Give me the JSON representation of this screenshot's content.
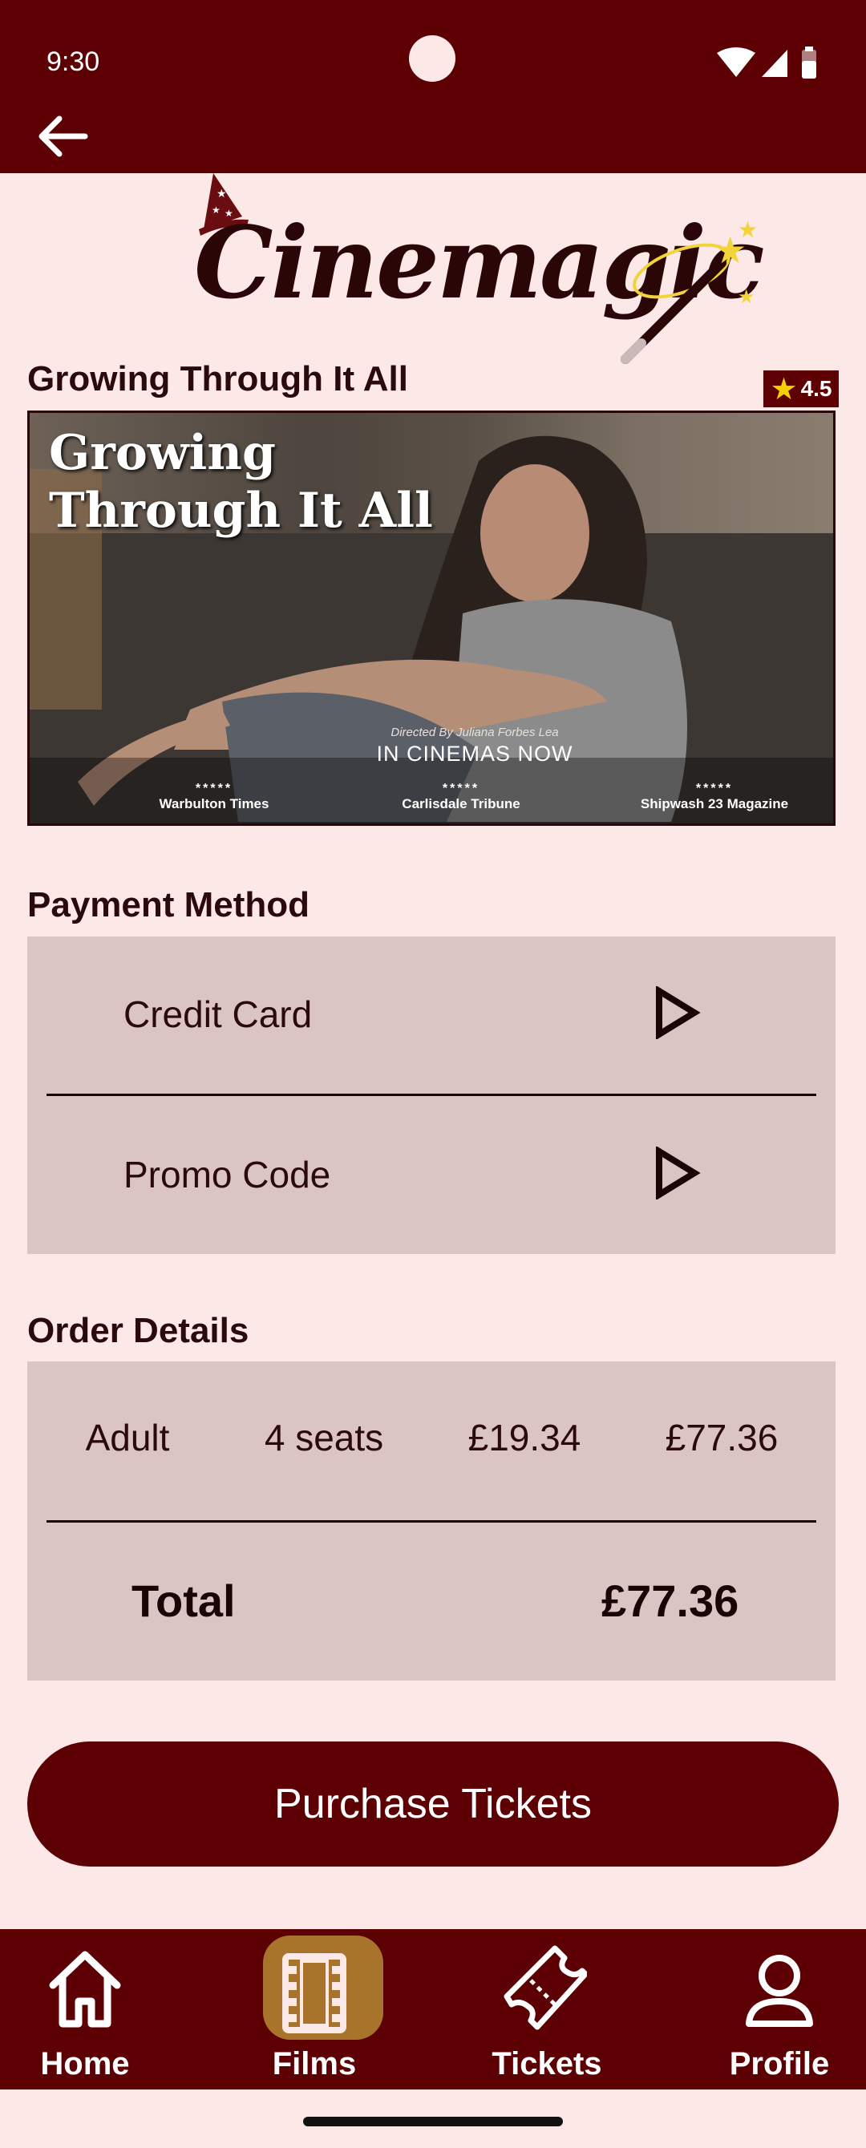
{
  "status_bar": {
    "time": "9:30"
  },
  "app_bar": {
    "back_icon": "arrow-left-icon"
  },
  "logo": {
    "text": "Cinemagic",
    "icons": [
      "wizard-hat-icon",
      "magic-wand-icon"
    ]
  },
  "film": {
    "title": "Growing Through It All",
    "rating": "4.5",
    "poster": {
      "title": "Growing\nThrough It All",
      "director": "Directed By Juliana Forbes Lea",
      "tagline": "IN CINEMAS NOW",
      "reviews": [
        {
          "stars": "*****",
          "source": "Warbulton Times"
        },
        {
          "stars": "*****",
          "source": "Carlisdale Tribune"
        },
        {
          "stars": "*****",
          "source": "Shipwash 23 Magazine"
        }
      ]
    }
  },
  "payment": {
    "heading": "Payment Method",
    "options": [
      {
        "label": "Credit Card"
      },
      {
        "label": "Promo Code"
      }
    ]
  },
  "order": {
    "heading": "Order Details",
    "line": {
      "type": "Adult",
      "seats": "4 seats",
      "unit_price": "£19.34",
      "subtotal": "£77.36"
    },
    "total_label": "Total",
    "total_value": "£77.36"
  },
  "purchase_button": "Purchase Tickets",
  "nav": {
    "items": [
      {
        "label": "Home",
        "icon": "home-icon"
      },
      {
        "label": "Films",
        "icon": "film-icon"
      },
      {
        "label": "Tickets",
        "icon": "ticket-icon"
      },
      {
        "label": "Profile",
        "icon": "profile-icon"
      }
    ],
    "active": "Films"
  },
  "colors": {
    "primary": "#5c0004",
    "background": "#fde8e8",
    "card": "#dbc4c4",
    "active_tab": "#a8742c",
    "star": "#f5d000"
  }
}
